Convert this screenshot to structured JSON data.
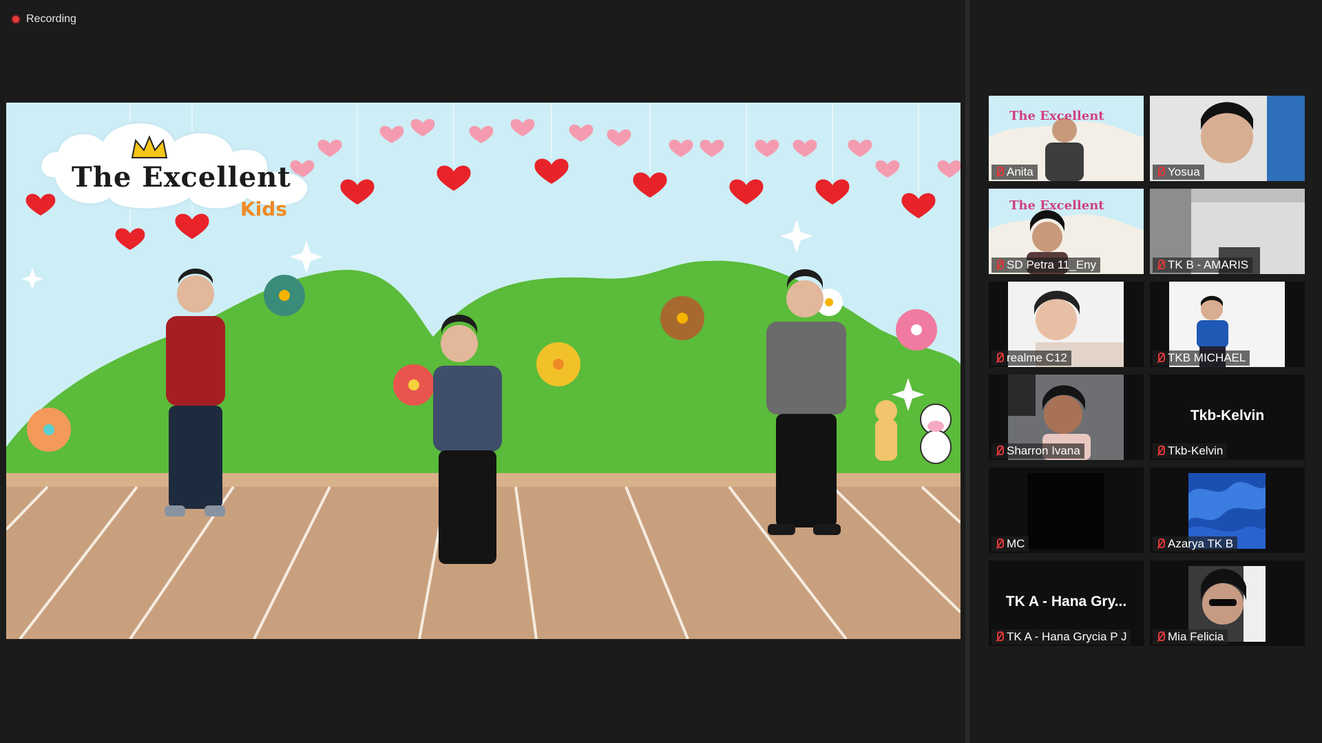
{
  "recording": {
    "label": "Recording",
    "indicator_color": "#e5393b"
  },
  "stage": {
    "brand_title": "The Excellent",
    "brand_sub": "Kids"
  },
  "participants": [
    {
      "name": "Anita",
      "muted": true
    },
    {
      "name": "Yosua",
      "muted": true
    },
    {
      "name": "SD Petra 11_Eny",
      "muted": true
    },
    {
      "name": "TK B - AMARIS",
      "muted": true
    },
    {
      "name": "realme C12",
      "muted": true
    },
    {
      "name": "TKB MICHAEL",
      "muted": true
    },
    {
      "name": "Sharron Ivana",
      "muted": true
    },
    {
      "name": "Tkb-Kelvin",
      "muted": true,
      "video_off_label": "Tkb-Kelvin"
    },
    {
      "name": "MC",
      "muted": true
    },
    {
      "name": "Azarya TK B",
      "muted": true
    },
    {
      "name": "TK A - Hana Grycia P J",
      "muted": true,
      "video_off_label": "TK A - Hana Gry..."
    },
    {
      "name": "Mia Felicia",
      "muted": true
    }
  ],
  "colors": {
    "background": "#1b1b1b",
    "mic_muted": "#e0383b",
    "hill": "#5bbb3a",
    "floor": "#c9a07e"
  }
}
